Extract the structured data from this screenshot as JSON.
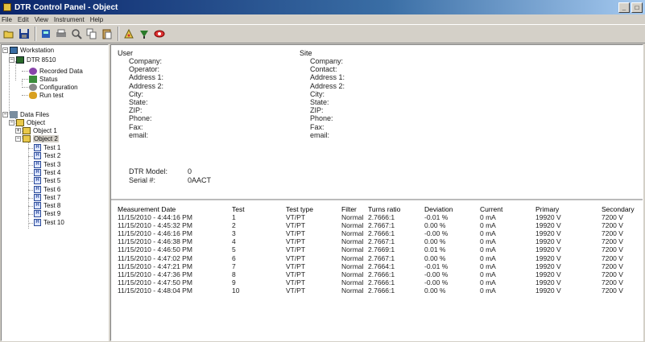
{
  "window": {
    "title": "DTR Control Panel - Object"
  },
  "menu": [
    "File",
    "Edit",
    "View",
    "Instrument",
    "Help"
  ],
  "toolbar": {
    "icons": [
      "open-icon",
      "save-icon",
      "instrument-icon",
      "print-icon",
      "search-icon",
      "copy-icon",
      "paste-icon",
      "test-icon",
      "probe-icon",
      "settings-icon"
    ]
  },
  "tree": {
    "workstation": "Workstation",
    "device": "DTR 8510",
    "recorded_data": "Recorded Data",
    "status": "Status",
    "configuration": "Configuration",
    "run_test": "Run test",
    "data_files": "Data Files",
    "object": "Object",
    "object1": "Object 1",
    "object2": "Object 2",
    "tests": [
      "Test 1",
      "Test 2",
      "Test 3",
      "Test 4",
      "Test 5",
      "Test 6",
      "Test 7",
      "Test 8",
      "Test 9",
      "Test 10"
    ]
  },
  "user": {
    "heading": "User",
    "fields": [
      "Company:",
      "Operator:",
      "Address 1:",
      "Address 2:",
      "City:",
      "State:",
      "ZIP:",
      "Phone:",
      "Fax:",
      "email:"
    ]
  },
  "site": {
    "heading": "Site",
    "fields": [
      "Company:",
      "Contact:",
      "Address 1:",
      "Address 2:",
      "City:",
      "State:",
      "ZIP:",
      "Phone:",
      "Fax:",
      "email:"
    ]
  },
  "device": {
    "model_label": "DTR Model:",
    "model_value": "0",
    "serial_label": "Serial #:",
    "serial_value": "0AACT"
  },
  "table": {
    "headers": [
      "Measurement Date",
      "Test",
      "Test type",
      "Filter",
      "Turns ratio",
      "Deviation",
      "Current",
      "Primary",
      "Secondary"
    ],
    "rows": [
      [
        "11/15/2010 - 4:44:16 PM",
        "1",
        "VT/PT",
        "Normal",
        "2.7666:1",
        "-0.01 %",
        "0 mA",
        "19920 V",
        "7200 V"
      ],
      [
        "11/15/2010 - 4:45:32 PM",
        "2",
        "VT/PT",
        "Normal",
        "2.7667:1",
        "0.00 %",
        "0 mA",
        "19920 V",
        "7200 V"
      ],
      [
        "11/15/2010 - 4:46:16 PM",
        "3",
        "VT/PT",
        "Normal",
        "2.7666:1",
        "-0.00 %",
        "0 mA",
        "19920 V",
        "7200 V"
      ],
      [
        "11/15/2010 - 4:46:38 PM",
        "4",
        "VT/PT",
        "Normal",
        "2.7667:1",
        "0.00 %",
        "0 mA",
        "19920 V",
        "7200 V"
      ],
      [
        "11/15/2010 - 4:46:50 PM",
        "5",
        "VT/PT",
        "Normal",
        "2.7669:1",
        "0.01 %",
        "0 mA",
        "19920 V",
        "7200 V"
      ],
      [
        "11/15/2010 - 4:47:02 PM",
        "6",
        "VT/PT",
        "Normal",
        "2.7667:1",
        "0.00 %",
        "0 mA",
        "19920 V",
        "7200 V"
      ],
      [
        "11/15/2010 - 4:47:21 PM",
        "7",
        "VT/PT",
        "Normal",
        "2.7664:1",
        "-0.01 %",
        "0 mA",
        "19920 V",
        "7200 V"
      ],
      [
        "11/15/2010 - 4:47:36 PM",
        "8",
        "VT/PT",
        "Normal",
        "2.7666:1",
        "-0.00 %",
        "0 mA",
        "19920 V",
        "7200 V"
      ],
      [
        "11/15/2010 - 4:47:50 PM",
        "9",
        "VT/PT",
        "Normal",
        "2.7666:1",
        "-0.00 %",
        "0 mA",
        "19920 V",
        "7200 V"
      ],
      [
        "11/15/2010 - 4:48:04 PM",
        "10",
        "VT/PT",
        "Normal",
        "2.7666:1",
        "0.00 %",
        "0 mA",
        "19920 V",
        "7200 V"
      ]
    ]
  },
  "colors": {
    "title_start": "#0a246a",
    "title_end": "#a6caf0",
    "folder": "#e8c84a",
    "face": "#d4d0c8"
  }
}
